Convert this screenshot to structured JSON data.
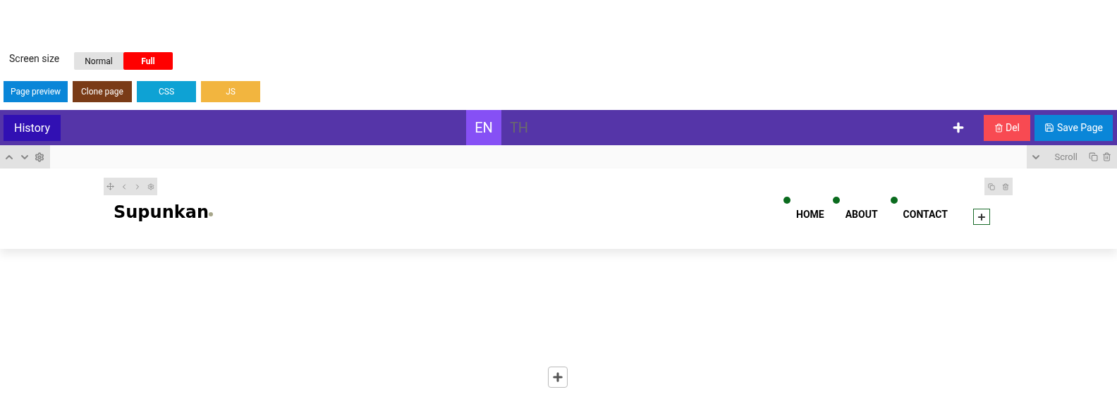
{
  "screen_size": {
    "label": "Screen size",
    "options": [
      {
        "label": "Normal",
        "selected": false
      },
      {
        "label": "Full",
        "selected": true
      }
    ]
  },
  "actions": [
    {
      "label": "Page preview",
      "kind": "preview"
    },
    {
      "label": "Clone page",
      "kind": "clone"
    },
    {
      "label": "CSS",
      "kind": "css"
    },
    {
      "label": "JS",
      "kind": "js"
    }
  ],
  "top_bar": {
    "history": "History",
    "languages": [
      {
        "label": "EN",
        "selected": true
      },
      {
        "label": "TH",
        "selected": false
      }
    ],
    "delete": "Del",
    "save": "Save Page"
  },
  "section_toolbar": {
    "scroll": "Scroll"
  },
  "site_header": {
    "logo": "Supunkan",
    "nav": [
      {
        "label": "HOME"
      },
      {
        "label": "ABOUT"
      },
      {
        "label": "CONTACT"
      }
    ]
  }
}
